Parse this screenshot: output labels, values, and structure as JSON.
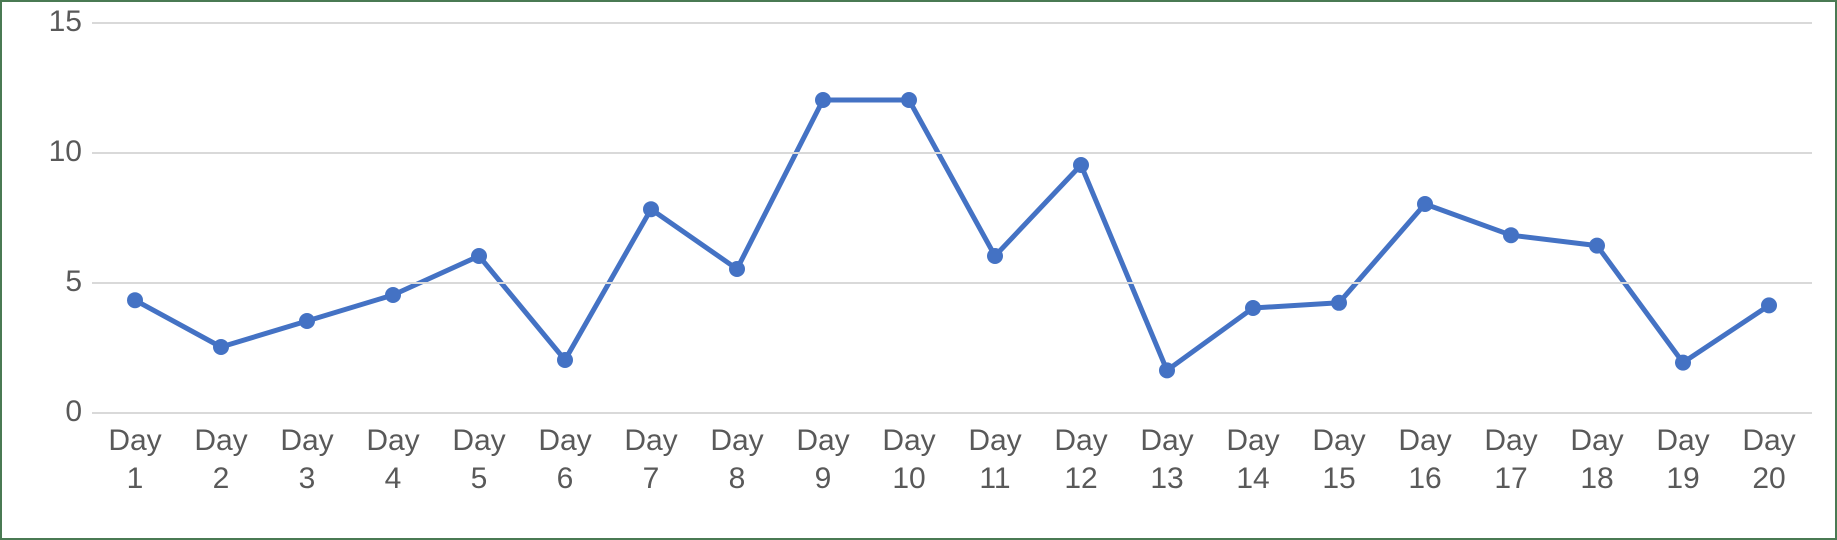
{
  "chart_data": {
    "type": "line",
    "categories": [
      "Day 1",
      "Day 2",
      "Day 3",
      "Day 4",
      "Day 5",
      "Day 6",
      "Day 7",
      "Day 8",
      "Day 9",
      "Day 10",
      "Day 11",
      "Day 12",
      "Day 13",
      "Day 14",
      "Day 15",
      "Day 16",
      "Day 17",
      "Day 18",
      "Day 19",
      "Day 20"
    ],
    "values": [
      4.3,
      2.5,
      3.5,
      4.5,
      6.0,
      2.0,
      7.8,
      5.5,
      12.0,
      12.0,
      6.0,
      9.5,
      1.6,
      4.0,
      4.2,
      8.0,
      6.8,
      6.4,
      1.9,
      4.1
    ],
    "ylim": [
      0,
      15
    ],
    "yticks": [
      0,
      5,
      10,
      15
    ],
    "title": "",
    "xlabel": "",
    "ylabel": "",
    "series_color": "#4472c4",
    "grid_color": "#d9d9d9",
    "marker_radius": 8,
    "line_width": 5
  }
}
